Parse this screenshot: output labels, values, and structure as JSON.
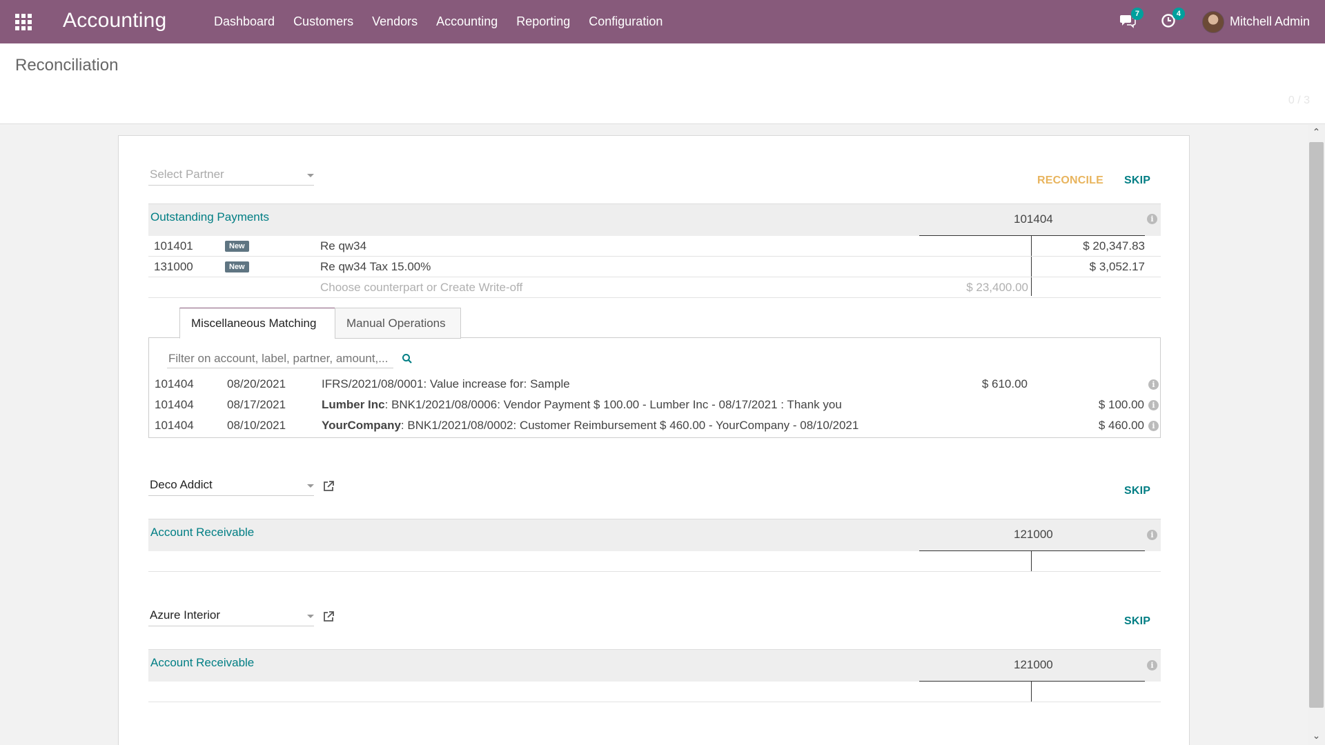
{
  "navbar": {
    "brand": "Accounting",
    "menu": [
      "Dashboard",
      "Customers",
      "Vendors",
      "Accounting",
      "Reporting",
      "Configuration"
    ],
    "messages_count": "7",
    "activities_count": "4",
    "user_name": "Mitchell Admin",
    "bg_color": "#875a7b"
  },
  "control_panel": {
    "title": "Reconciliation",
    "pager": "0 / 3"
  },
  "line1": {
    "partner_placeholder": "Select Partner",
    "reconcile_label": "RECONCILE",
    "skip_label": "SKIP",
    "header_title": "Outstanding Payments",
    "header_account": "101404",
    "lines": [
      {
        "account": "101401",
        "badge": "New",
        "label": "Re qw34",
        "credit": "$ 20,347.83"
      },
      {
        "account": "131000",
        "badge": "New",
        "label": "Re qw34 Tax 15.00%",
        "credit": "$ 3,052.17"
      }
    ],
    "counterpart_placeholder": "Choose counterpart or Create Write-off",
    "counterpart_amount": "$ 23,400.00",
    "tabs": [
      "Miscellaneous Matching",
      "Manual Operations"
    ],
    "filter_placeholder": "Filter on account, label, partner, amount,...",
    "matches": [
      {
        "account": "101404",
        "date": "08/20/2021",
        "partner": "",
        "label": "IFRS/2021/08/0001: Value increase for: Sample",
        "debit": "$ 610.00",
        "credit": ""
      },
      {
        "account": "101404",
        "date": "08/17/2021",
        "partner": "Lumber Inc",
        "label": ": BNK1/2021/08/0006: Vendor Payment $ 100.00 - Lumber Inc - 08/17/2021 : Thank you",
        "debit": "",
        "credit": "$ 100.00"
      },
      {
        "account": "101404",
        "date": "08/10/2021",
        "partner": "YourCompany",
        "label": ": BNK1/2021/08/0002: Customer Reimbursement $ 460.00 - YourCompany - 08/10/2021",
        "debit": "",
        "credit": "$ 460.00"
      }
    ]
  },
  "line2": {
    "partner": "Deco Addict",
    "skip_label": "SKIP",
    "header_title": "Account Receivable",
    "header_account": "121000"
  },
  "line3": {
    "partner": "Azure Interior",
    "skip_label": "SKIP",
    "header_title": "Account Receivable",
    "header_account": "121000"
  }
}
